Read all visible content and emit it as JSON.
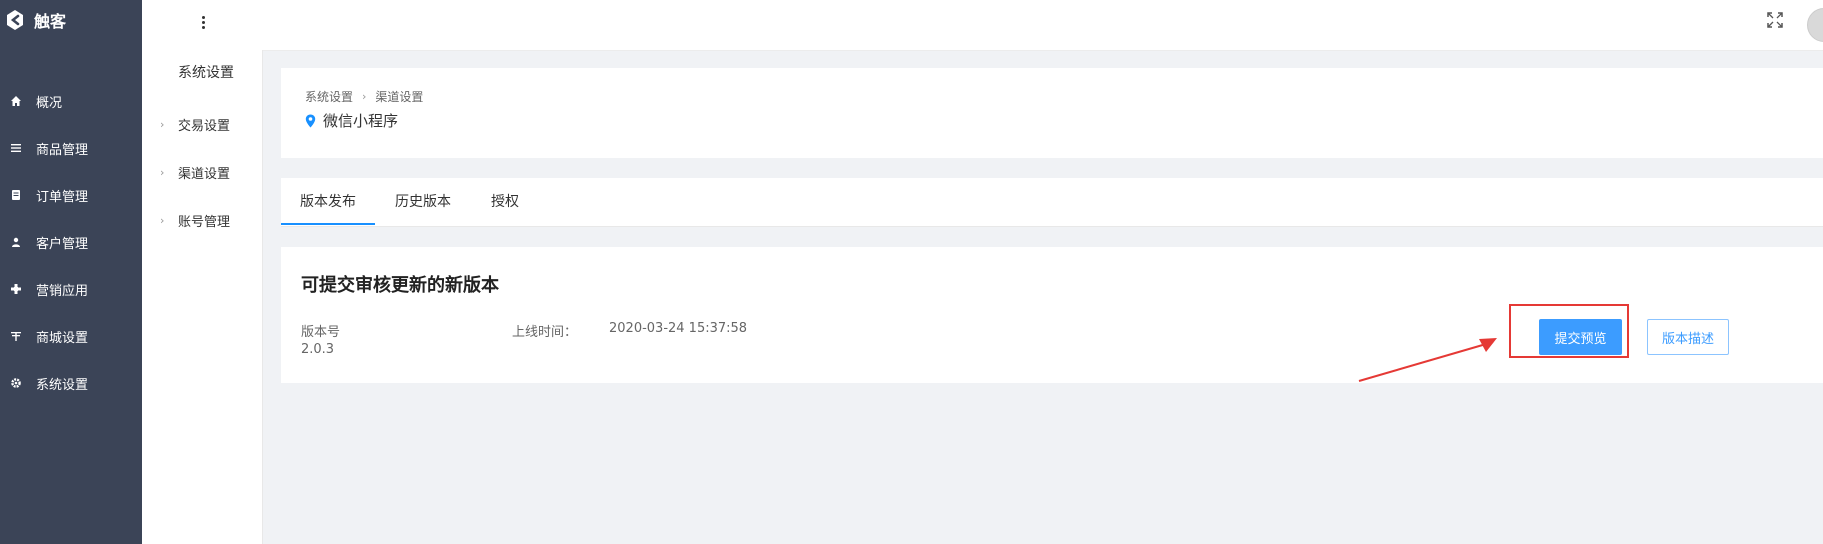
{
  "brand": {
    "name": "触客",
    "color": "#3c9cff"
  },
  "sidebar": {
    "items": [
      {
        "label": "概况",
        "icon": "home-icon"
      },
      {
        "label": "商品管理",
        "icon": "list-icon"
      },
      {
        "label": "订单管理",
        "icon": "document-icon"
      },
      {
        "label": "客户管理",
        "icon": "user-icon"
      },
      {
        "label": "营销应用",
        "icon": "puzzle-icon"
      },
      {
        "label": "商城设置",
        "icon": "shop-icon"
      },
      {
        "label": "系统设置",
        "icon": "gear-icon"
      }
    ]
  },
  "subnav": {
    "title": "系统设置",
    "items": [
      {
        "label": "交易设置"
      },
      {
        "label": "渠道设置"
      },
      {
        "label": "账号管理"
      }
    ]
  },
  "breadcrumb": {
    "items": [
      "系统设置",
      "渠道设置"
    ],
    "page_title": "微信小程序"
  },
  "tabs": [
    {
      "label": "版本发布",
      "active": true
    },
    {
      "label": "历史版本",
      "active": false
    },
    {
      "label": "授权",
      "active": false
    }
  ],
  "release": {
    "title": "可提交审核更新的新版本",
    "version_label": "版本号",
    "version_value": "2.0.3",
    "time_label": "上线时间：",
    "time_value": "2020-03-24 15:37:58",
    "submit_label": "提交预览",
    "describe_label": "版本描述"
  },
  "colors": {
    "sidebar_bg": "#3b4457",
    "primary": "#3c9cff",
    "annotation": "#e53935"
  }
}
